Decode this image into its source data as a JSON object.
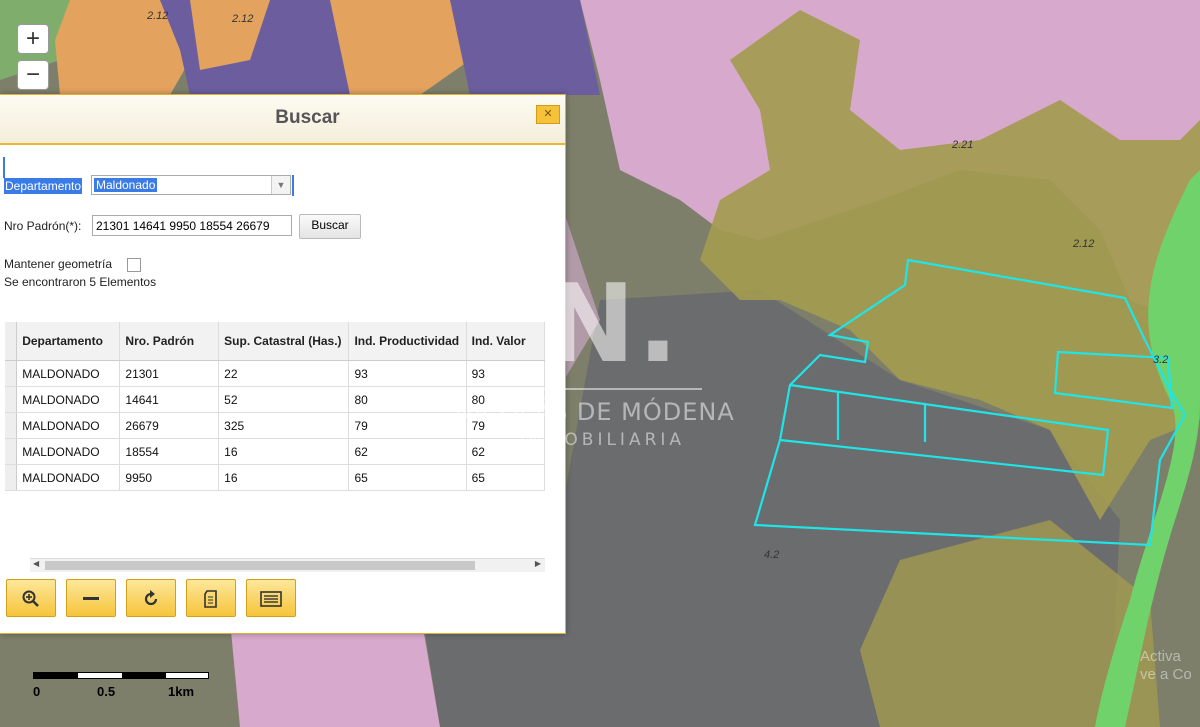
{
  "map": {
    "zone_labels": [
      "2.12",
      "2.12",
      "2.21",
      "2.12",
      "3.2",
      "4.2"
    ],
    "scale_labels": [
      "0",
      "0.5",
      "1km"
    ],
    "zoom_in": "+",
    "zoom_out": "−",
    "faded_text": "Activa\nve a Co"
  },
  "watermark": {
    "logo": "N.",
    "name": "NICOLÁS DE MÓDENA",
    "sub": "INMOBILIARIA"
  },
  "dialog": {
    "title": "Buscar",
    "close_icon": "close-icon",
    "departamento_label": "Departamento",
    "departamento_value": "Maldonado",
    "padron_label": "Nro Padrón(*):",
    "padron_value": "21301 14641 9950 18554 26679",
    "buscar_button": "Buscar",
    "mantener_label": "Mantener geometría",
    "result_text": "Se encontraron 5 Elementos",
    "table": {
      "headers": [
        "Departamento",
        "Nro. Padrón",
        "Sup. Catastral (Has.)",
        "Ind. Productividad",
        "Ind. Valor"
      ],
      "rows": [
        [
          "MALDONADO",
          "21301",
          "22",
          "93",
          "93"
        ],
        [
          "MALDONADO",
          "14641",
          "52",
          "80",
          "80"
        ],
        [
          "MALDONADO",
          "26679",
          "325",
          "79",
          "79"
        ],
        [
          "MALDONADO",
          "18554",
          "16",
          "62",
          "62"
        ],
        [
          "MALDONADO",
          "9950",
          "16",
          "65",
          "65"
        ]
      ]
    },
    "toolbar": [
      "zoom-in-icon",
      "minus-icon",
      "refresh-icon",
      "document-icon",
      "list-icon"
    ]
  }
}
